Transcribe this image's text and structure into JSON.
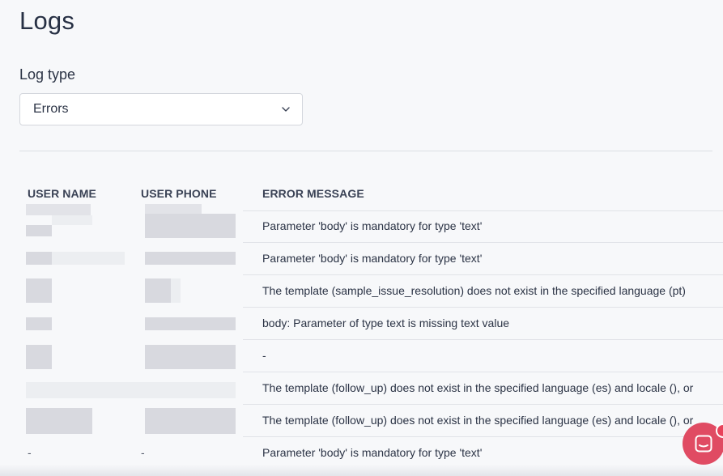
{
  "page": {
    "title": "Logs"
  },
  "log_type": {
    "label": "Log type",
    "selected": "Errors",
    "icon": "chevron-down-icon"
  },
  "table": {
    "headers": {
      "user_name": "USER NAME",
      "user_phone": "USER PHONE",
      "error_message": "ERROR MESSAGE"
    },
    "rows": [
      {
        "user_name": "",
        "user_phone": "",
        "error_message": "Parameter 'body' is mandatory for type 'text'"
      },
      {
        "user_name": "",
        "user_phone": "",
        "error_message": "Parameter 'body' is mandatory for type 'text'"
      },
      {
        "user_name": "",
        "user_phone": "",
        "error_message": "The template (sample_issue_resolution) does not exist in the specified language (pt)"
      },
      {
        "user_name": "",
        "user_phone": "",
        "error_message": "body: Parameter of type text is missing text value"
      },
      {
        "user_name": "",
        "user_phone": "",
        "error_message": "-"
      },
      {
        "user_name": "",
        "user_phone": "",
        "error_message": "The template (follow_up) does not exist in the specified language (es) and locale (), or"
      },
      {
        "user_name": "",
        "user_phone": "",
        "error_message": "The template (follow_up) does not exist in the specified language (es) and locale (), or"
      },
      {
        "user_name": "-",
        "user_phone": "-",
        "error_message": "Parameter 'body' is mandatory for type 'text'"
      }
    ]
  },
  "chat_launcher": {
    "icon": "chat-icon",
    "color": "#e04b63"
  }
}
